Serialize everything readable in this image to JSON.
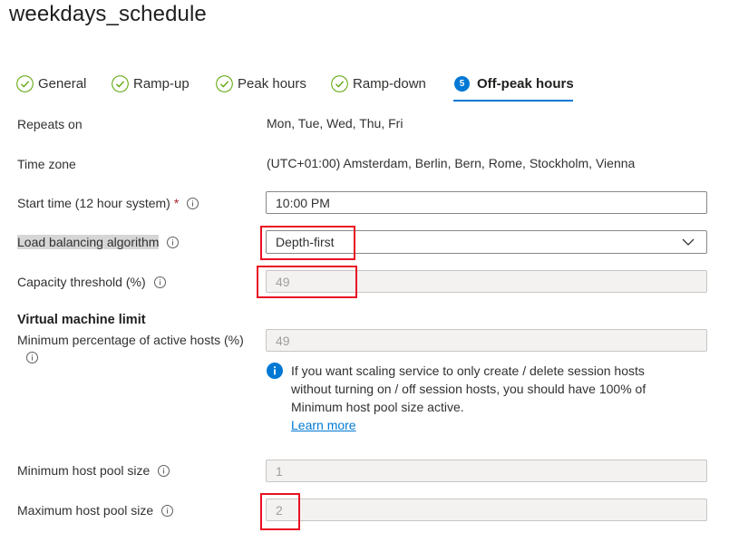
{
  "page": {
    "title": "weekdays_schedule"
  },
  "tabs": [
    {
      "label": "General",
      "state": "complete"
    },
    {
      "label": "Ramp-up",
      "state": "complete"
    },
    {
      "label": "Peak hours",
      "state": "complete"
    },
    {
      "label": "Ramp-down",
      "state": "complete"
    },
    {
      "label": "Off-peak hours",
      "state": "active",
      "step": "5"
    }
  ],
  "fields": {
    "repeats_on": {
      "label": "Repeats on",
      "value": "Mon, Tue, Wed, Thu, Fri"
    },
    "time_zone": {
      "label": "Time zone",
      "value": "(UTC+01:00) Amsterdam, Berlin, Bern, Rome, Stockholm, Vienna"
    },
    "start_time": {
      "label": "Start time (12 hour system)",
      "required_mark": "*",
      "value": "10:00 PM"
    },
    "load_balancing": {
      "label": "Load balancing algorithm",
      "value": "Depth-first"
    },
    "capacity_threshold": {
      "label": "Capacity threshold (%)",
      "value": "49"
    },
    "vm_limit_heading": "Virtual machine limit",
    "min_active_hosts": {
      "label": "Minimum percentage of active hosts (%)",
      "value": "49"
    },
    "min_pool_size": {
      "label": "Minimum host pool size",
      "value": "1"
    },
    "max_pool_size": {
      "label": "Maximum host pool size",
      "value": "2"
    }
  },
  "info_message": {
    "text": "If you want scaling service to only create / delete session hosts without turning on / off session hosts, you should have 100% of Minimum host pool size active.",
    "link": "Learn more"
  },
  "colors": {
    "accent": "#0078d4",
    "success": "#57a300",
    "highlight_box": "#e81123"
  }
}
